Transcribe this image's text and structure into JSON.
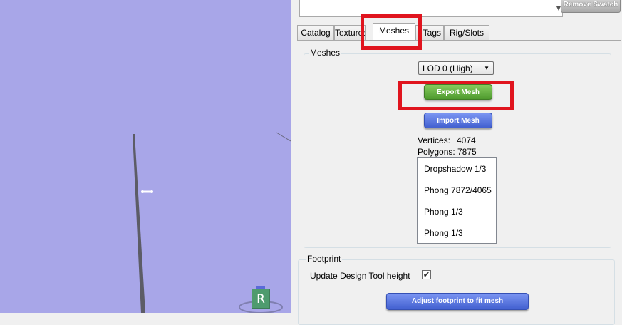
{
  "viewport": {
    "r_icon_label": "R"
  },
  "swatch": {
    "remove_label": "Remove Swatch",
    "scroll_glyph": "▼"
  },
  "tabs": [
    {
      "label": "Catalog"
    },
    {
      "label": "Textures"
    },
    {
      "label": "Meshes",
      "active": true
    },
    {
      "label": "Tags"
    },
    {
      "label": "Rig/Slots"
    }
  ],
  "meshes": {
    "group_title": "Meshes",
    "lod_selected": "LOD 0 (High)",
    "lod_arrow": "▼",
    "export_label": "Export Mesh",
    "import_label": "Import Mesh",
    "vertices_label": "Vertices:",
    "vertices_value": "4074",
    "polygons_label": "Polygons:",
    "polygons_value": "7875",
    "materials": [
      "Dropshadow 1/3",
      "Phong 7872/4065",
      "Phong 1/3",
      "Phong 1/3"
    ]
  },
  "footprint": {
    "group_title": "Footprint",
    "update_label": "Update Design Tool height",
    "update_checked": true,
    "check_glyph": "✔",
    "adjust_label": "Adjust footprint to fit mesh"
  },
  "colors": {
    "viewport_bg": "#a8a6e8",
    "highlight": "#e0141e",
    "export_green": "#5aa83a",
    "import_blue": "#4a68d8"
  }
}
